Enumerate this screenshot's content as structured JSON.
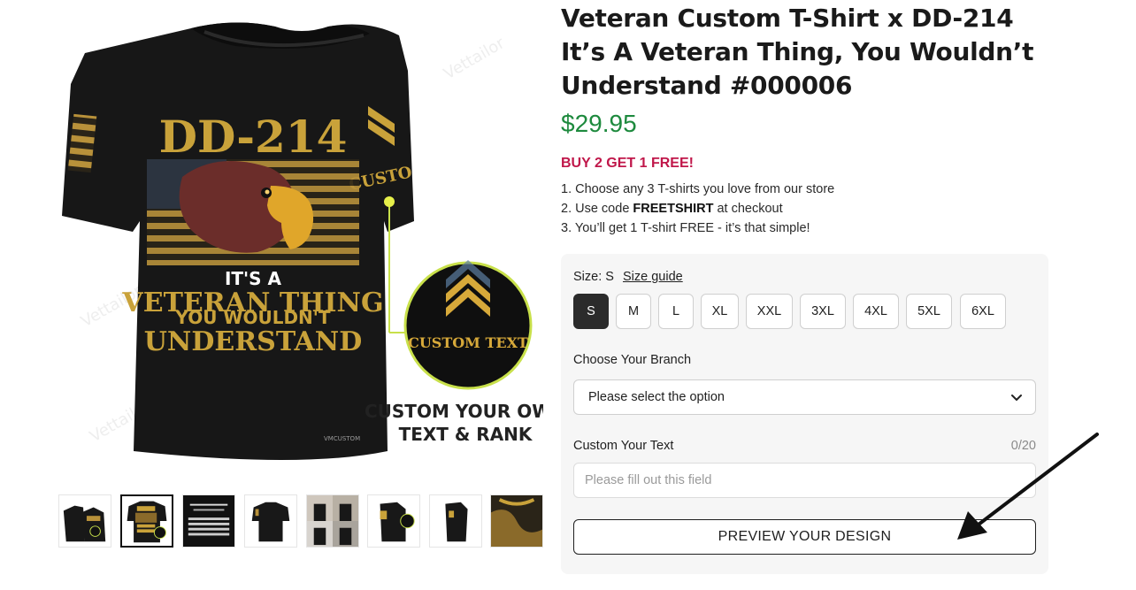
{
  "product": {
    "title": "Veteran Custom T-Shirt x DD-214 It’s A Veteran Thing, You Wouldn’t Understand #000006",
    "price": "$29.95",
    "promo": "BUY 2 GET 1 FREE!",
    "steps": {
      "step1": "1. Choose any 3 T-shirts you love from our store",
      "step2_pre": "2. Use code ",
      "step2_code": "FREETSHIRT",
      "step2_post": " at checkout",
      "step3": "3. You’ll get 1 T-shirt FREE - it’s that simple!"
    }
  },
  "image": {
    "shirt_headline": "DD-214",
    "shirt_line1": "IT'S A",
    "shirt_line2": "VETERAN THING",
    "shirt_line3": "YOU WOULDN'T",
    "shirt_line4": "UNDERSTAND",
    "sleeve_text": "CUSTO",
    "badge_text": "CUSTOM TEXT",
    "callout_line1": "CUSTOM YOUR OWN",
    "callout_line2": "TEXT & RANK",
    "watermark": "Vettailor",
    "tag": "VMCUSTOM"
  },
  "colors": {
    "price": "#1e8a3e",
    "promo": "#c0174a",
    "gold": "#c9a23a",
    "shirt": "#171717",
    "selected_size": "#2b2b2b",
    "callout_line": "#c8e04a"
  },
  "thumbnails": [
    {
      "name": "front-back",
      "active": false
    },
    {
      "name": "front-closeup",
      "active": true
    },
    {
      "name": "font-chart",
      "active": false
    },
    {
      "name": "back",
      "active": false
    },
    {
      "name": "models",
      "active": false
    },
    {
      "name": "side-sleeve",
      "active": false
    },
    {
      "name": "side-plain",
      "active": false
    },
    {
      "name": "detail",
      "active": false
    }
  ],
  "options": {
    "size_label": "Size:",
    "size_value": "S",
    "size_guide": "Size guide",
    "sizes": [
      "S",
      "M",
      "L",
      "XL",
      "XXL",
      "3XL",
      "4XL",
      "5XL",
      "6XL"
    ],
    "selected_size": "S",
    "branch_label": "Choose Your Branch",
    "branch_value": "Please select the option",
    "branch_icon": "chevron-down-icon",
    "text_label": "Custom Your Text",
    "text_counter": "0/20",
    "text_placeholder": "Please fill out this field",
    "text_value": "",
    "preview_button": "PREVIEW YOUR DESIGN"
  }
}
